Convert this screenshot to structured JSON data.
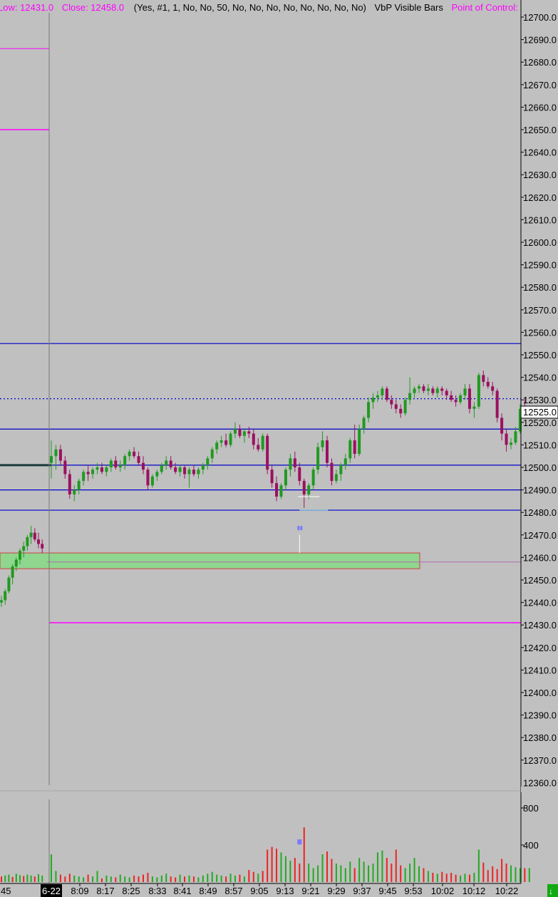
{
  "header": {
    "low_label": "Low: 12431.0",
    "close_label": "Close: 12458.0",
    "params": "(Yes, #1, 1, No, No, 50, No, No, No, No, No, No, No, No)",
    "study_name": "VbP Visible Bars",
    "point_of_control": "Point of Control:"
  },
  "colors": {
    "background": "#c0c0c0",
    "up_candle": "#1f9a1f",
    "down_candle": "#9b1060",
    "magenta": "#ff00ff",
    "blue_level": "#0000cc",
    "vol_up": "#22aa22",
    "vol_down": "#ee2222",
    "zone_fill": "#8fd68f",
    "zone_border": "#d04040"
  },
  "price_axis": {
    "ticks": [
      "12700.0",
      "12690.0",
      "12680.0",
      "12670.0",
      "12660.0",
      "12650.0",
      "12640.0",
      "12630.0",
      "12620.0",
      "12610.0",
      "12600.0",
      "12590.0",
      "12580.0",
      "12570.0",
      "12560.0",
      "12550.0",
      "12540.0",
      "12530.0",
      "12520.0",
      "12510.0",
      "12500.0",
      "12490.0",
      "12480.0",
      "12470.0",
      "12460.0",
      "12450.0",
      "12440.0",
      "12430.0",
      "12420.0",
      "12410.0",
      "12400.0",
      "12390.0",
      "12380.0",
      "12370.0"
    ],
    "cut_tick": "12360.0",
    "last_price": "12525.0"
  },
  "volume_axis": {
    "ticks": [
      "800",
      "400"
    ]
  },
  "time_axis": {
    "left_label": "45",
    "date_label": "6-22",
    "labels": [
      "8:09",
      "8:17",
      "8:25",
      "8:33",
      "8:41",
      "8:49",
      "8:57",
      "9:05",
      "9:13",
      "9:21",
      "9:29",
      "9:37",
      "9:45",
      "9:53",
      "10:02",
      "10:12",
      "10:22"
    ]
  },
  "chart_data": {
    "type": "candlestick",
    "ylim": [
      12360,
      12703
    ],
    "blue_levels": [
      12555,
      12517,
      12501,
      12490,
      12481
    ],
    "dotted_level": 12530.5,
    "magenta_levels": [
      12686,
      12650,
      12431
    ],
    "gray_level": 12458,
    "green_zone": [
      12455,
      12462
    ],
    "pre_session": [
      {
        "o": 12440,
        "h": 12443,
        "l": 12438,
        "c": 12441
      },
      {
        "o": 12441,
        "h": 12446,
        "l": 12439,
        "c": 12445
      },
      {
        "o": 12445,
        "h": 12452,
        "l": 12444,
        "c": 12451
      },
      {
        "o": 12451,
        "h": 12457,
        "l": 12448,
        "c": 12456
      },
      {
        "o": 12456,
        "h": 12460,
        "l": 12454,
        "c": 12459
      },
      {
        "o": 12459,
        "h": 12464,
        "l": 12457,
        "c": 12463
      },
      {
        "o": 12463,
        "h": 12467,
        "l": 12460,
        "c": 12465
      },
      {
        "o": 12465,
        "h": 12470,
        "l": 12463,
        "c": 12469
      },
      {
        "o": 12469,
        "h": 12474,
        "l": 12466,
        "c": 12471
      },
      {
        "o": 12471,
        "h": 12473,
        "l": 12467,
        "c": 12468
      },
      {
        "o": 12468,
        "h": 12471,
        "l": 12464,
        "c": 12466
      },
      {
        "o": 12466,
        "h": 12468,
        "l": 12462,
        "c": 12464
      }
    ],
    "candles": [
      {
        "o": 12502,
        "h": 12512,
        "l": 12495,
        "c": 12505
      },
      {
        "o": 12505,
        "h": 12510,
        "l": 12499,
        "c": 12508
      },
      {
        "o": 12508,
        "h": 12510,
        "l": 12501,
        "c": 12503
      },
      {
        "o": 12503,
        "h": 12505,
        "l": 12495,
        "c": 12497
      },
      {
        "o": 12497,
        "h": 12499,
        "l": 12486,
        "c": 12488
      },
      {
        "o": 12488,
        "h": 12492,
        "l": 12485,
        "c": 12490
      },
      {
        "o": 12490,
        "h": 12495,
        "l": 12488,
        "c": 12494
      },
      {
        "o": 12494,
        "h": 12499,
        "l": 12492,
        "c": 12498
      },
      {
        "o": 12498,
        "h": 12501,
        "l": 12494,
        "c": 12497
      },
      {
        "o": 12497,
        "h": 12500,
        "l": 12495,
        "c": 12499
      },
      {
        "o": 12499,
        "h": 12502,
        "l": 12497,
        "c": 12500
      },
      {
        "o": 12500,
        "h": 12502,
        "l": 12497,
        "c": 12498
      },
      {
        "o": 12498,
        "h": 12501,
        "l": 12496,
        "c": 12500
      },
      {
        "o": 12500,
        "h": 12504,
        "l": 12498,
        "c": 12503
      },
      {
        "o": 12503,
        "h": 12505,
        "l": 12499,
        "c": 12500
      },
      {
        "o": 12500,
        "h": 12503,
        "l": 12498,
        "c": 12501
      },
      {
        "o": 12501,
        "h": 12506,
        "l": 12499,
        "c": 12505
      },
      {
        "o": 12505,
        "h": 12508,
        "l": 12503,
        "c": 12507
      },
      {
        "o": 12507,
        "h": 12509,
        "l": 12504,
        "c": 12505
      },
      {
        "o": 12505,
        "h": 12507,
        "l": 12501,
        "c": 12502
      },
      {
        "o": 12502,
        "h": 12505,
        "l": 12497,
        "c": 12499
      },
      {
        "o": 12499,
        "h": 12500,
        "l": 12490,
        "c": 12492
      },
      {
        "o": 12492,
        "h": 12497,
        "l": 12491,
        "c": 12496
      },
      {
        "o": 12496,
        "h": 12499,
        "l": 12494,
        "c": 12498
      },
      {
        "o": 12498,
        "h": 12502,
        "l": 12497,
        "c": 12501
      },
      {
        "o": 12501,
        "h": 12505,
        "l": 12499,
        "c": 12503
      },
      {
        "o": 12503,
        "h": 12505,
        "l": 12499,
        "c": 12500
      },
      {
        "o": 12500,
        "h": 12502,
        "l": 12497,
        "c": 12498
      },
      {
        "o": 12498,
        "h": 12501,
        "l": 12496,
        "c": 12500
      },
      {
        "o": 12500,
        "h": 12501,
        "l": 12495,
        "c": 12497
      },
      {
        "o": 12497,
        "h": 12500,
        "l": 12491,
        "c": 12499
      },
      {
        "o": 12499,
        "h": 12501,
        "l": 12496,
        "c": 12497
      },
      {
        "o": 12497,
        "h": 12500,
        "l": 12495,
        "c": 12499
      },
      {
        "o": 12499,
        "h": 12502,
        "l": 12497,
        "c": 12501
      },
      {
        "o": 12501,
        "h": 12505,
        "l": 12499,
        "c": 12504
      },
      {
        "o": 12504,
        "h": 12509,
        "l": 12502,
        "c": 12508
      },
      {
        "o": 12508,
        "h": 12512,
        "l": 12506,
        "c": 12511
      },
      {
        "o": 12511,
        "h": 12514,
        "l": 12509,
        "c": 12512
      },
      {
        "o": 12512,
        "h": 12515,
        "l": 12509,
        "c": 12510
      },
      {
        "o": 12510,
        "h": 12516,
        "l": 12509,
        "c": 12515
      },
      {
        "o": 12515,
        "h": 12520,
        "l": 12513,
        "c": 12517
      },
      {
        "o": 12517,
        "h": 12519,
        "l": 12513,
        "c": 12514
      },
      {
        "o": 12514,
        "h": 12517,
        "l": 12511,
        "c": 12516
      },
      {
        "o": 12516,
        "h": 12518,
        "l": 12513,
        "c": 12515
      },
      {
        "o": 12515,
        "h": 12517,
        "l": 12508,
        "c": 12510
      },
      {
        "o": 12510,
        "h": 12513,
        "l": 12507,
        "c": 12508
      },
      {
        "o": 12508,
        "h": 12515,
        "l": 12507,
        "c": 12514
      },
      {
        "o": 12514,
        "h": 12515,
        "l": 12497,
        "c": 12499
      },
      {
        "o": 12499,
        "h": 12501,
        "l": 12491,
        "c": 12493
      },
      {
        "o": 12493,
        "h": 12496,
        "l": 12485,
        "c": 12487
      },
      {
        "o": 12487,
        "h": 12493,
        "l": 12486,
        "c": 12492
      },
      {
        "o": 12492,
        "h": 12500,
        "l": 12490,
        "c": 12499
      },
      {
        "o": 12499,
        "h": 12506,
        "l": 12496,
        "c": 12504
      },
      {
        "o": 12504,
        "h": 12507,
        "l": 12498,
        "c": 12500
      },
      {
        "o": 12500,
        "h": 12502,
        "l": 12492,
        "c": 12494
      },
      {
        "o": 12494,
        "h": 12495,
        "l": 12482,
        "c": 12488
      },
      {
        "o": 12488,
        "h": 12493,
        "l": 12486,
        "c": 12492
      },
      {
        "o": 12492,
        "h": 12500,
        "l": 12490,
        "c": 12499
      },
      {
        "o": 12499,
        "h": 12511,
        "l": 12497,
        "c": 12509
      },
      {
        "o": 12509,
        "h": 12516,
        "l": 12507,
        "c": 12512
      },
      {
        "o": 12512,
        "h": 12514,
        "l": 12500,
        "c": 12502
      },
      {
        "o": 12502,
        "h": 12504,
        "l": 12492,
        "c": 12494
      },
      {
        "o": 12494,
        "h": 12499,
        "l": 12493,
        "c": 12497
      },
      {
        "o": 12497,
        "h": 12502,
        "l": 12494,
        "c": 12501
      },
      {
        "o": 12501,
        "h": 12506,
        "l": 12499,
        "c": 12504
      },
      {
        "o": 12504,
        "h": 12513,
        "l": 12502,
        "c": 12512
      },
      {
        "o": 12512,
        "h": 12519,
        "l": 12504,
        "c": 12506
      },
      {
        "o": 12506,
        "h": 12519,
        "l": 12505,
        "c": 12517
      },
      {
        "o": 12517,
        "h": 12523,
        "l": 12515,
        "c": 12522
      },
      {
        "o": 12522,
        "h": 12531,
        "l": 12520,
        "c": 12529
      },
      {
        "o": 12529,
        "h": 12533,
        "l": 12526,
        "c": 12531
      },
      {
        "o": 12531,
        "h": 12534,
        "l": 12529,
        "c": 12532
      },
      {
        "o": 12532,
        "h": 12536,
        "l": 12530,
        "c": 12535
      },
      {
        "o": 12535,
        "h": 12536,
        "l": 12529,
        "c": 12530
      },
      {
        "o": 12530,
        "h": 12532,
        "l": 12526,
        "c": 12528
      },
      {
        "o": 12528,
        "h": 12530,
        "l": 12524,
        "c": 12526
      },
      {
        "o": 12526,
        "h": 12528,
        "l": 12522,
        "c": 12524
      },
      {
        "o": 12524,
        "h": 12531,
        "l": 12523,
        "c": 12530
      },
      {
        "o": 12530,
        "h": 12540,
        "l": 12528,
        "c": 12533
      },
      {
        "o": 12533,
        "h": 12536,
        "l": 12531,
        "c": 12535
      },
      {
        "o": 12535,
        "h": 12537,
        "l": 12533,
        "c": 12536
      },
      {
        "o": 12536,
        "h": 12537,
        "l": 12533,
        "c": 12534
      },
      {
        "o": 12534,
        "h": 12537,
        "l": 12532,
        "c": 12535
      },
      {
        "o": 12535,
        "h": 12536,
        "l": 12532,
        "c": 12533
      },
      {
        "o": 12533,
        "h": 12536,
        "l": 12531,
        "c": 12535
      },
      {
        "o": 12535,
        "h": 12536,
        "l": 12532,
        "c": 12534
      },
      {
        "o": 12534,
        "h": 12535,
        "l": 12530,
        "c": 12532
      },
      {
        "o": 12532,
        "h": 12534,
        "l": 12529,
        "c": 12530
      },
      {
        "o": 12530,
        "h": 12532,
        "l": 12527,
        "c": 12529
      },
      {
        "o": 12529,
        "h": 12533,
        "l": 12528,
        "c": 12532
      },
      {
        "o": 12532,
        "h": 12537,
        "l": 12530,
        "c": 12535
      },
      {
        "o": 12535,
        "h": 12537,
        "l": 12524,
        "c": 12526
      },
      {
        "o": 12526,
        "h": 12529,
        "l": 12522,
        "c": 12527
      },
      {
        "o": 12527,
        "h": 12542,
        "l": 12526,
        "c": 12541
      },
      {
        "o": 12541,
        "h": 12543,
        "l": 12536,
        "c": 12538
      },
      {
        "o": 12538,
        "h": 12540,
        "l": 12535,
        "c": 12536
      },
      {
        "o": 12536,
        "h": 12538,
        "l": 12532,
        "c": 12534
      },
      {
        "o": 12534,
        "h": 12535,
        "l": 12520,
        "c": 12522
      },
      {
        "o": 12522,
        "h": 12524,
        "l": 12512,
        "c": 12515
      },
      {
        "o": 12515,
        "h": 12517,
        "l": 12507,
        "c": 12510
      },
      {
        "o": 12510,
        "h": 12513,
        "l": 12508,
        "c": 12511
      },
      {
        "o": 12511,
        "h": 12518,
        "l": 12510,
        "c": 12516
      },
      {
        "o": 12516,
        "h": 12528,
        "l": 12515,
        "c": 12526
      },
      {
        "o": 12526,
        "h": 12531,
        "l": 12523,
        "c": 12525
      }
    ],
    "volume_ylim": [
      0,
      1000
    ],
    "pre_volume": [
      60,
      70,
      80,
      55,
      90,
      75,
      65,
      80,
      70,
      60,
      85,
      70
    ],
    "volume": [
      300,
      120,
      80,
      60,
      90,
      70,
      60,
      50,
      80,
      60,
      120,
      40,
      70,
      60,
      50,
      80,
      60,
      50,
      70,
      60,
      80,
      100,
      60,
      50,
      70,
      90,
      60,
      50,
      80,
      60,
      70,
      60,
      50,
      70,
      90,
      110,
      80,
      70,
      60,
      90,
      70,
      80,
      60,
      130,
      110,
      90,
      120,
      350,
      380,
      360,
      320,
      280,
      230,
      260,
      200,
      590,
      200,
      150,
      180,
      300,
      330,
      250,
      200,
      180,
      150,
      220,
      150,
      260,
      220,
      180,
      200,
      320,
      340,
      260,
      200,
      350,
      180,
      150,
      200,
      260,
      170,
      150,
      120,
      100,
      90,
      110,
      90,
      100,
      80,
      70,
      90,
      80,
      100,
      350,
      210,
      130,
      170,
      140,
      250,
      200,
      180,
      160,
      150,
      150,
      150
    ],
    "volume_up": [
      true,
      true,
      false,
      false,
      false,
      true,
      true,
      true,
      false,
      true,
      true,
      false,
      true,
      true,
      false,
      true,
      true,
      true,
      false,
      false,
      false,
      false,
      true,
      true,
      true,
      true,
      false,
      false,
      true,
      false,
      true,
      false,
      true,
      true,
      true,
      true,
      true,
      true,
      false,
      true,
      true,
      false,
      true,
      false,
      false,
      true,
      false,
      false,
      false,
      false,
      true,
      true,
      true,
      false,
      false,
      false,
      true,
      true,
      true,
      true,
      false,
      false,
      true,
      true,
      true,
      true,
      false,
      true,
      true,
      true,
      true,
      true,
      true,
      false,
      false,
      false,
      false,
      true,
      true,
      true,
      true,
      false,
      true,
      false,
      true,
      false,
      false,
      false,
      false,
      true,
      true,
      false,
      true,
      true,
      false,
      false,
      false,
      false,
      false,
      false,
      true,
      true,
      true,
      false,
      true
    ]
  }
}
